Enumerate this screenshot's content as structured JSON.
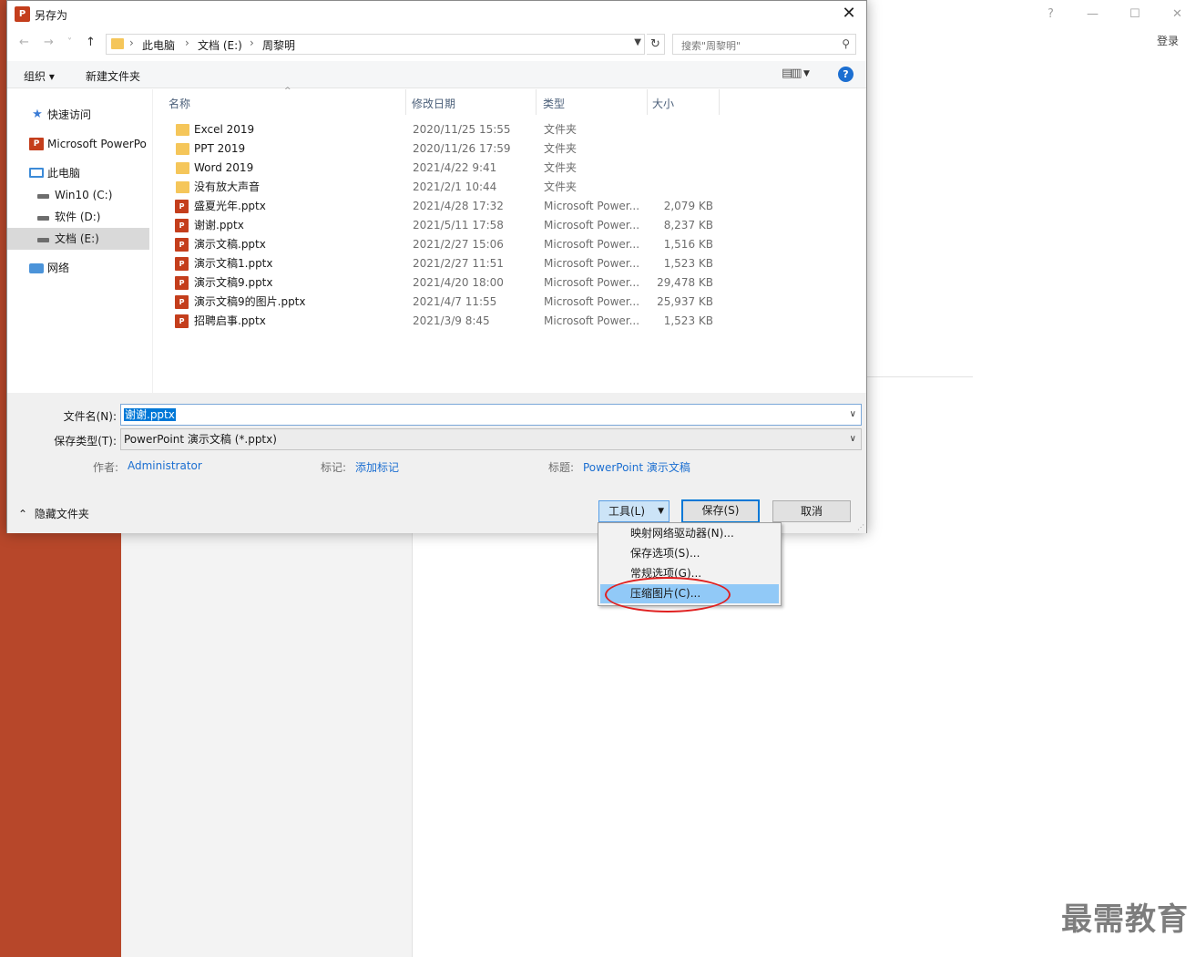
{
  "window": {
    "title": "另存为",
    "app_icon_letter": "P"
  },
  "background": {
    "help": "?",
    "minimize": "—",
    "maximize": "☐",
    "close": "✕",
    "login": "登录",
    "watermark": "最需教育"
  },
  "nav": {
    "back": "←",
    "forward": "→",
    "recent": "˅",
    "up": "↑",
    "refresh": "↻",
    "breadcrumb": [
      "此电脑",
      "文档 (E:)",
      "周黎明"
    ],
    "breadcrumb_sep": "›",
    "search_placeholder": "搜索\"周黎明\""
  },
  "toolbar": {
    "organize": "组织 ▾",
    "new_folder": "新建文件夹",
    "help": "?"
  },
  "sidebar": {
    "items": [
      {
        "label": "快速访问",
        "icon": "star-icon"
      },
      {
        "label": "Microsoft PowerPo",
        "icon": "powerpoint-icon"
      },
      {
        "label": "此电脑",
        "icon": "pc-icon"
      },
      {
        "label": "Win10 (C:)",
        "icon": "drive-icon"
      },
      {
        "label": "软件 (D:)",
        "icon": "drive-icon"
      },
      {
        "label": "文档 (E:)",
        "icon": "drive-icon"
      },
      {
        "label": "网络",
        "icon": "network-icon"
      }
    ]
  },
  "columns": {
    "name": "名称",
    "modified": "修改日期",
    "type": "类型",
    "size": "大小"
  },
  "files": [
    {
      "name": "Excel 2019",
      "date": "2020/11/25 15:55",
      "type": "文件夹",
      "size": "",
      "kind": "folder"
    },
    {
      "name": "PPT 2019",
      "date": "2020/11/26 17:59",
      "type": "文件夹",
      "size": "",
      "kind": "folder"
    },
    {
      "name": "Word 2019",
      "date": "2021/4/22 9:41",
      "type": "文件夹",
      "size": "",
      "kind": "folder"
    },
    {
      "name": "没有放大声音",
      "date": "2021/2/1 10:44",
      "type": "文件夹",
      "size": "",
      "kind": "folder"
    },
    {
      "name": "盛夏光年.pptx",
      "date": "2021/4/28 17:32",
      "type": "Microsoft Power...",
      "size": "2,079 KB",
      "kind": "pptx"
    },
    {
      "name": "谢谢.pptx",
      "date": "2021/5/11 17:58",
      "type": "Microsoft Power...",
      "size": "8,237 KB",
      "kind": "pptx"
    },
    {
      "name": "演示文稿.pptx",
      "date": "2021/2/27 15:06",
      "type": "Microsoft Power...",
      "size": "1,516 KB",
      "kind": "pptx"
    },
    {
      "name": "演示文稿1.pptx",
      "date": "2021/2/27 11:51",
      "type": "Microsoft Power...",
      "size": "1,523 KB",
      "kind": "pptx"
    },
    {
      "name": "演示文稿9.pptx",
      "date": "2021/4/20 18:00",
      "type": "Microsoft Power...",
      "size": "29,478 KB",
      "kind": "pptx"
    },
    {
      "name": "演示文稿9的图片.pptx",
      "date": "2021/4/7 11:55",
      "type": "Microsoft Power...",
      "size": "25,937 KB",
      "kind": "pptx"
    },
    {
      "name": "招聘启事.pptx",
      "date": "2021/3/9 8:45",
      "type": "Microsoft Power...",
      "size": "1,523 KB",
      "kind": "pptx"
    }
  ],
  "form": {
    "filename_label": "文件名(N):",
    "filename_value": "谢谢.pptx",
    "filetype_label": "保存类型(T):",
    "filetype_value": "PowerPoint 演示文稿 (*.pptx)",
    "author_label": "作者:",
    "author_value": "Administrator",
    "tags_label": "标记:",
    "tags_value": "添加标记",
    "title_label": "标题:",
    "title_value": "PowerPoint 演示文稿",
    "hide_folders": "隐藏文件夹"
  },
  "buttons": {
    "tools": "工具(L)",
    "save": "保存(S)",
    "cancel": "取消"
  },
  "tools_menu": {
    "items": [
      "映射网络驱动器(N)...",
      "保存选项(S)...",
      "常规选项(G)...",
      "压缩图片(C)..."
    ],
    "highlighted_index": 3
  },
  "colors": {
    "ppt_accent": "#b7472a",
    "selection": "#0078d7",
    "menu_highlight": "#91c9f7",
    "annotation_circle": "#e02020"
  }
}
